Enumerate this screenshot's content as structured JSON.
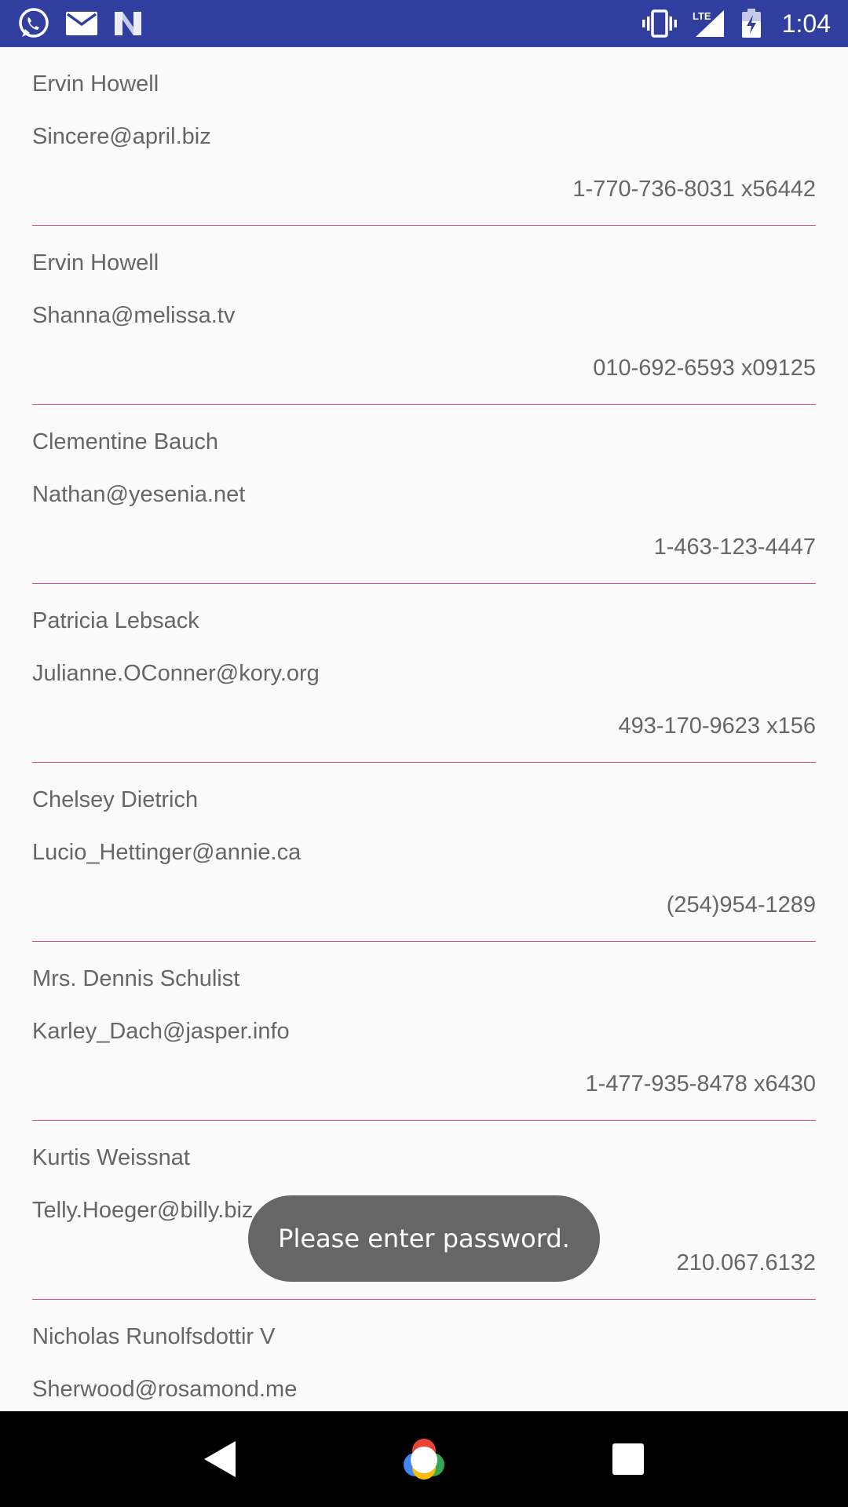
{
  "status_bar": {
    "time": "1:04",
    "network": "LTE",
    "icons": [
      "whatsapp-icon",
      "mail-icon",
      "n-app-icon",
      "vibrate-icon",
      "lte-signal-icon",
      "battery-charging-icon"
    ]
  },
  "contacts": [
    {
      "name": "Ervin Howell",
      "email": "Sincere@april.biz",
      "phone": "1-770-736-8031 x56442"
    },
    {
      "name": "Ervin Howell",
      "email": "Shanna@melissa.tv",
      "phone": "010-692-6593 x09125"
    },
    {
      "name": "Clementine Bauch",
      "email": "Nathan@yesenia.net",
      "phone": "1-463-123-4447"
    },
    {
      "name": "Patricia Lebsack",
      "email": "Julianne.OConner@kory.org",
      "phone": "493-170-9623 x156"
    },
    {
      "name": "Chelsey Dietrich",
      "email": "Lucio_Hettinger@annie.ca",
      "phone": "(254)954-1289"
    },
    {
      "name": "Mrs. Dennis Schulist",
      "email": "Karley_Dach@jasper.info",
      "phone": "1-477-935-8478 x6430"
    },
    {
      "name": "Kurtis Weissnat",
      "email": "Telly.Hoeger@billy.biz",
      "phone": "210.067.6132"
    },
    {
      "name": "Nicholas Runolfsdottir V",
      "email": "Sherwood@rosamond.me",
      "phone": ""
    }
  ],
  "toast": {
    "message": "Please enter password."
  },
  "colors": {
    "status_bar": "#303f9f",
    "divider": "#e0517f",
    "text": "#666666",
    "toast_bg": "#666666",
    "nav_bar": "#000000"
  },
  "nav_bar": {
    "icons": [
      "back-icon",
      "home-icon",
      "recents-icon"
    ]
  }
}
